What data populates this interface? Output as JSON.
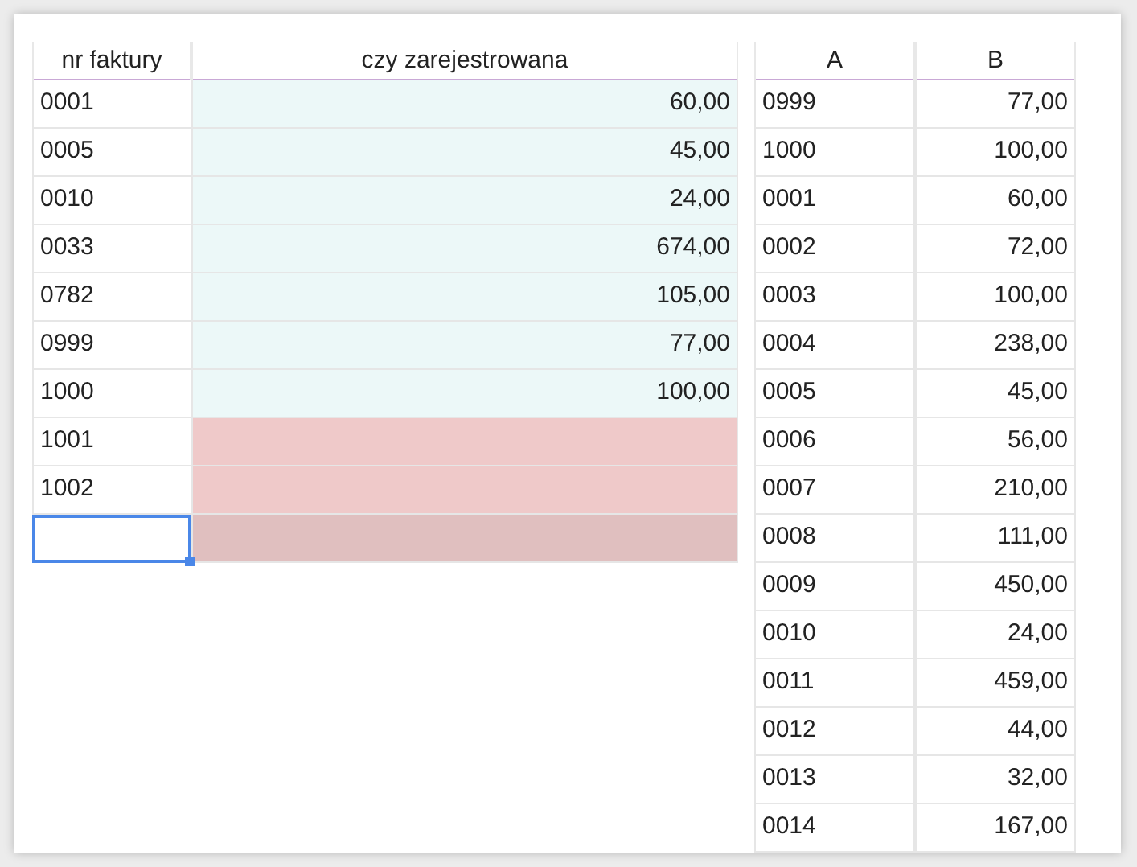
{
  "left_table": {
    "columns": [
      "nr faktury",
      "czy zarejestrowana"
    ],
    "rows": [
      {
        "nr": "0001",
        "value": "60,00",
        "kind": "found",
        "selected": false
      },
      {
        "nr": "0005",
        "value": "45,00",
        "kind": "found",
        "selected": false
      },
      {
        "nr": "0010",
        "value": "24,00",
        "kind": "found",
        "selected": false
      },
      {
        "nr": "0033",
        "value": "674,00",
        "kind": "found",
        "selected": false
      },
      {
        "nr": "0782",
        "value": "105,00",
        "kind": "found",
        "selected": false
      },
      {
        "nr": "0999",
        "value": "77,00",
        "kind": "found",
        "selected": false
      },
      {
        "nr": "1000",
        "value": "100,00",
        "kind": "found",
        "selected": false
      },
      {
        "nr": "1001",
        "kind": "missing",
        "selected": false
      },
      {
        "nr": "1002",
        "kind": "missing",
        "selected": false
      },
      {
        "kind": "missing",
        "selected": true
      }
    ]
  },
  "right_table": {
    "columns": [
      "A",
      "B"
    ],
    "rows": [
      [
        "0999",
        "77,00"
      ],
      [
        "1000",
        "100,00"
      ],
      [
        "0001",
        "60,00"
      ],
      [
        "0002",
        "72,00"
      ],
      [
        "0003",
        "100,00"
      ],
      [
        "0004",
        "238,00"
      ],
      [
        "0005",
        "45,00"
      ],
      [
        "0006",
        "56,00"
      ],
      [
        "0007",
        "210,00"
      ],
      [
        "0008",
        "111,00"
      ],
      [
        "0009",
        "450,00"
      ],
      [
        "0010",
        "24,00"
      ],
      [
        "0011",
        "459,00"
      ],
      [
        "0012",
        "44,00"
      ],
      [
        "0013",
        "32,00"
      ],
      [
        "0014",
        "167,00"
      ]
    ]
  }
}
